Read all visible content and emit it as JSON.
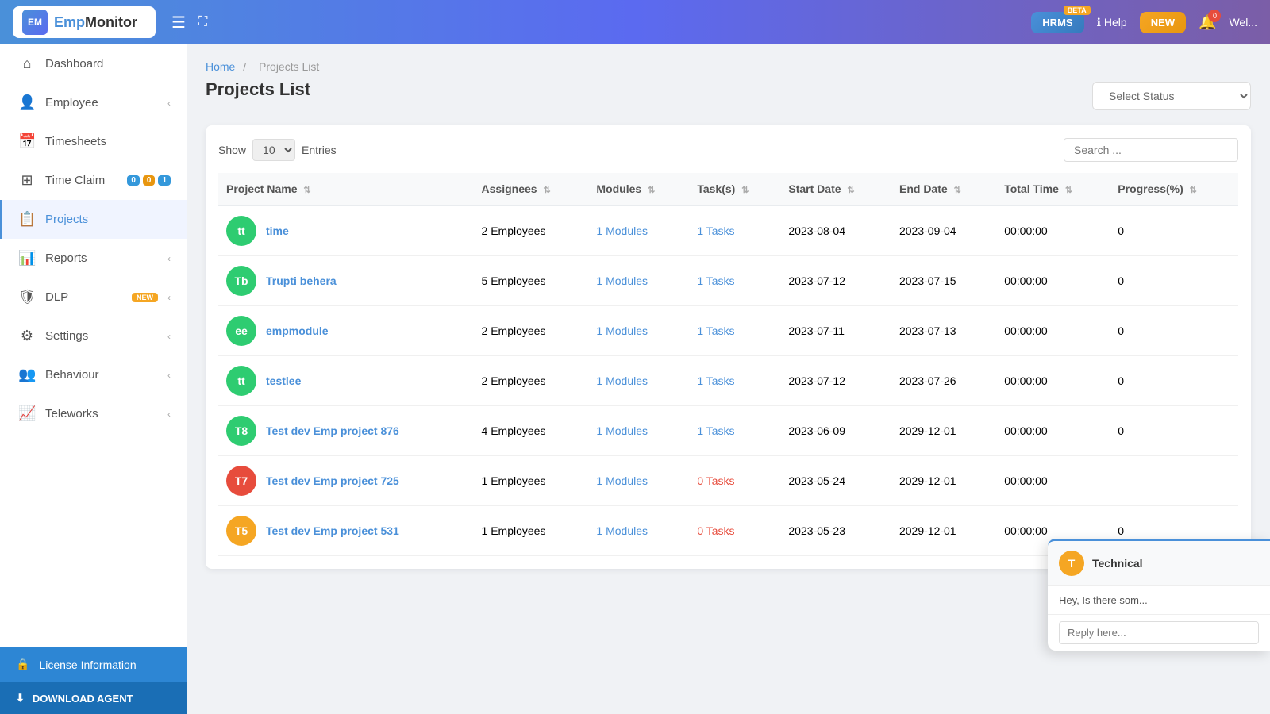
{
  "app": {
    "name": "EmpMonitor",
    "name_prefix": "Emp",
    "name_suffix": "Monitor"
  },
  "header": {
    "menu_icon": "☰",
    "expand_icon": "⛶",
    "hrms_label": "HRMS",
    "hrms_badge": "BETA",
    "help_label": "Help",
    "new_label": "NEW",
    "notif_count": "0",
    "welcome_label": "Wel..."
  },
  "sidebar": {
    "items": [
      {
        "id": "dashboard",
        "label": "Dashboard",
        "icon": "⌂",
        "active": false
      },
      {
        "id": "employee",
        "label": "Employee",
        "icon": "👤",
        "active": false,
        "arrow": "‹"
      },
      {
        "id": "timesheets",
        "label": "Timesheets",
        "icon": "📅",
        "active": false
      },
      {
        "id": "timeclaim",
        "label": "Time Claim",
        "icon": "⚙",
        "active": false,
        "badges": [
          "0",
          "0",
          "1"
        ]
      },
      {
        "id": "projects",
        "label": "Projects",
        "icon": "📋",
        "active": true
      },
      {
        "id": "reports",
        "label": "Reports",
        "icon": "📊",
        "active": false,
        "arrow": "‹"
      },
      {
        "id": "dlp",
        "label": "DLP",
        "icon": "🛡",
        "active": false,
        "arrow": "‹",
        "new": true
      },
      {
        "id": "settings",
        "label": "Settings",
        "icon": "⚙",
        "active": false,
        "arrow": "‹"
      },
      {
        "id": "behaviour",
        "label": "Behaviour",
        "icon": "👥",
        "active": false,
        "arrow": "‹"
      },
      {
        "id": "teleworks",
        "label": "Teleworks",
        "icon": "📈",
        "active": false,
        "arrow": "‹"
      }
    ],
    "license_label": "License Information",
    "license_icon": "🔒",
    "download_label": "DOWNLOAD AGENT",
    "download_icon": "⬇"
  },
  "breadcrumb": {
    "home": "Home",
    "separator": "/",
    "current": "Projects List"
  },
  "page": {
    "title": "Projects List",
    "select_status_placeholder": "Select Status",
    "show_label": "Show",
    "entries_label": "Entries",
    "show_value": "10",
    "search_placeholder": "Search ..."
  },
  "table": {
    "columns": [
      {
        "id": "project_name",
        "label": "Project Name"
      },
      {
        "id": "assignees",
        "label": "Assignees"
      },
      {
        "id": "modules",
        "label": "Modules"
      },
      {
        "id": "tasks",
        "label": "Task(s)"
      },
      {
        "id": "start_date",
        "label": "Start Date"
      },
      {
        "id": "end_date",
        "label": "End Date"
      },
      {
        "id": "total_time",
        "label": "Total Time"
      },
      {
        "id": "progress",
        "label": "Progress(%)"
      }
    ],
    "rows": [
      {
        "initials": "tt",
        "color": "#2ecc71",
        "name": "time",
        "assignees": "2  Employees",
        "modules": "1  Modules",
        "tasks": "1  Tasks",
        "tasks_zero": false,
        "start_date": "2023-08-04",
        "end_date": "2023-09-04",
        "total_time": "00:00:00",
        "progress": "0"
      },
      {
        "initials": "Tb",
        "color": "#2ecc71",
        "name": "Trupti behera",
        "assignees": "5  Employees",
        "modules": "1  Modules",
        "tasks": "1  Tasks",
        "tasks_zero": false,
        "start_date": "2023-07-12",
        "end_date": "2023-07-15",
        "total_time": "00:00:00",
        "progress": "0"
      },
      {
        "initials": "ee",
        "color": "#2ecc71",
        "name": "empmodule",
        "assignees": "2  Employees",
        "modules": "1  Modules",
        "tasks": "1  Tasks",
        "tasks_zero": false,
        "start_date": "2023-07-11",
        "end_date": "2023-07-13",
        "total_time": "00:00:00",
        "progress": "0"
      },
      {
        "initials": "tt",
        "color": "#2ecc71",
        "name": "testlee",
        "assignees": "2  Employees",
        "modules": "1  Modules",
        "tasks": "1  Tasks",
        "tasks_zero": false,
        "start_date": "2023-07-12",
        "end_date": "2023-07-26",
        "total_time": "00:00:00",
        "progress": "0"
      },
      {
        "initials": "T8",
        "color": "#2ecc71",
        "name": "Test dev Emp project 876",
        "assignees": "4  Employees",
        "modules": "1  Modules",
        "tasks": "1  Tasks",
        "tasks_zero": false,
        "start_date": "2023-06-09",
        "end_date": "2029-12-01",
        "total_time": "00:00:00",
        "progress": "0"
      },
      {
        "initials": "T7",
        "color": "#e74c3c",
        "name": "Test dev Emp project 725",
        "assignees": "1  Employees",
        "modules": "1  Modules",
        "tasks": "0  Tasks",
        "tasks_zero": true,
        "start_date": "2023-05-24",
        "end_date": "2029-12-01",
        "total_time": "00:00:00",
        "progress": ""
      },
      {
        "initials": "T5",
        "color": "#f5a623",
        "name": "Test dev Emp project 531",
        "assignees": "1  Employees",
        "modules": "1  Modules",
        "tasks": "0  Tasks",
        "tasks_zero": true,
        "start_date": "2023-05-23",
        "end_date": "2029-12-01",
        "total_time": "00:00:00",
        "progress": "0"
      }
    ]
  },
  "chat": {
    "avatar_letter": "T",
    "name": "Technical",
    "message": "Hey, Is there som...",
    "input_placeholder": "Reply here..."
  }
}
